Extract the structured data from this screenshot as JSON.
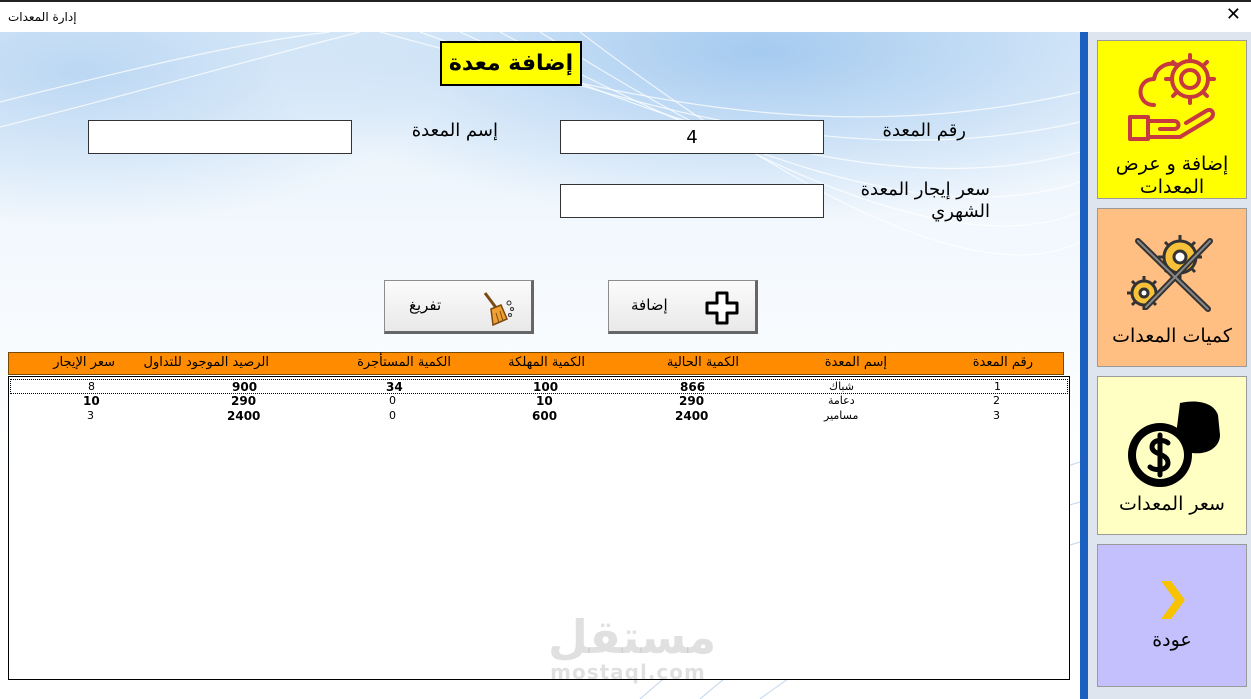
{
  "window": {
    "title": "إدارة المعدات",
    "close_glyph": "✕"
  },
  "header": {
    "title": "إضافة معدة"
  },
  "form": {
    "equipment_number": {
      "label": "رقم المعدة",
      "value": "4"
    },
    "equipment_name": {
      "label": "إسم المعدة",
      "value": ""
    },
    "monthly_rent_price": {
      "label": "سعر إيجار المعدة الشهري",
      "value": ""
    }
  },
  "buttons": {
    "add": {
      "label": "إضافة",
      "icon": "plus-icon"
    },
    "clear": {
      "label": "تفريغ",
      "icon": "broom-icon"
    }
  },
  "table": {
    "columns": [
      "رقم المعدة",
      "إسم المعدة",
      "الكمية الحالية",
      "الكمية المهلكة",
      "الكمية المستأجرة",
      "الرصيد الموجود للتداول",
      "سعر الإيجار"
    ],
    "rows": [
      [
        "1",
        "شباك",
        "866",
        "100",
        "34",
        "900",
        "8"
      ],
      [
        "2",
        "دعامة",
        "290",
        "10",
        "0",
        "290",
        "10"
      ],
      [
        "3",
        "مسامير",
        "2400",
        "600",
        "0",
        "2400",
        "3"
      ]
    ]
  },
  "sidebar": {
    "items": [
      {
        "label": "إضافة و عرض المعدات",
        "icon": "gear-hand-icon",
        "color": "#ffff00"
      },
      {
        "label": "كميات المعدات",
        "icon": "tools-gears-icon",
        "color": "#ffbe82"
      },
      {
        "label": "سعر المعدات",
        "icon": "money-hand-icon",
        "color": "#ffffc4"
      },
      {
        "label": "عودة",
        "icon": "chevron-right-icon",
        "color": "#c4c0fd"
      }
    ]
  },
  "watermark": {
    "arabic": "مستقل",
    "latin": "mostaql.com"
  },
  "colors": {
    "accent_blue": "#1b5fc0",
    "table_header": "#ff8c00",
    "header_yellow": "#ffff00",
    "icon_red": "#c6393f"
  }
}
